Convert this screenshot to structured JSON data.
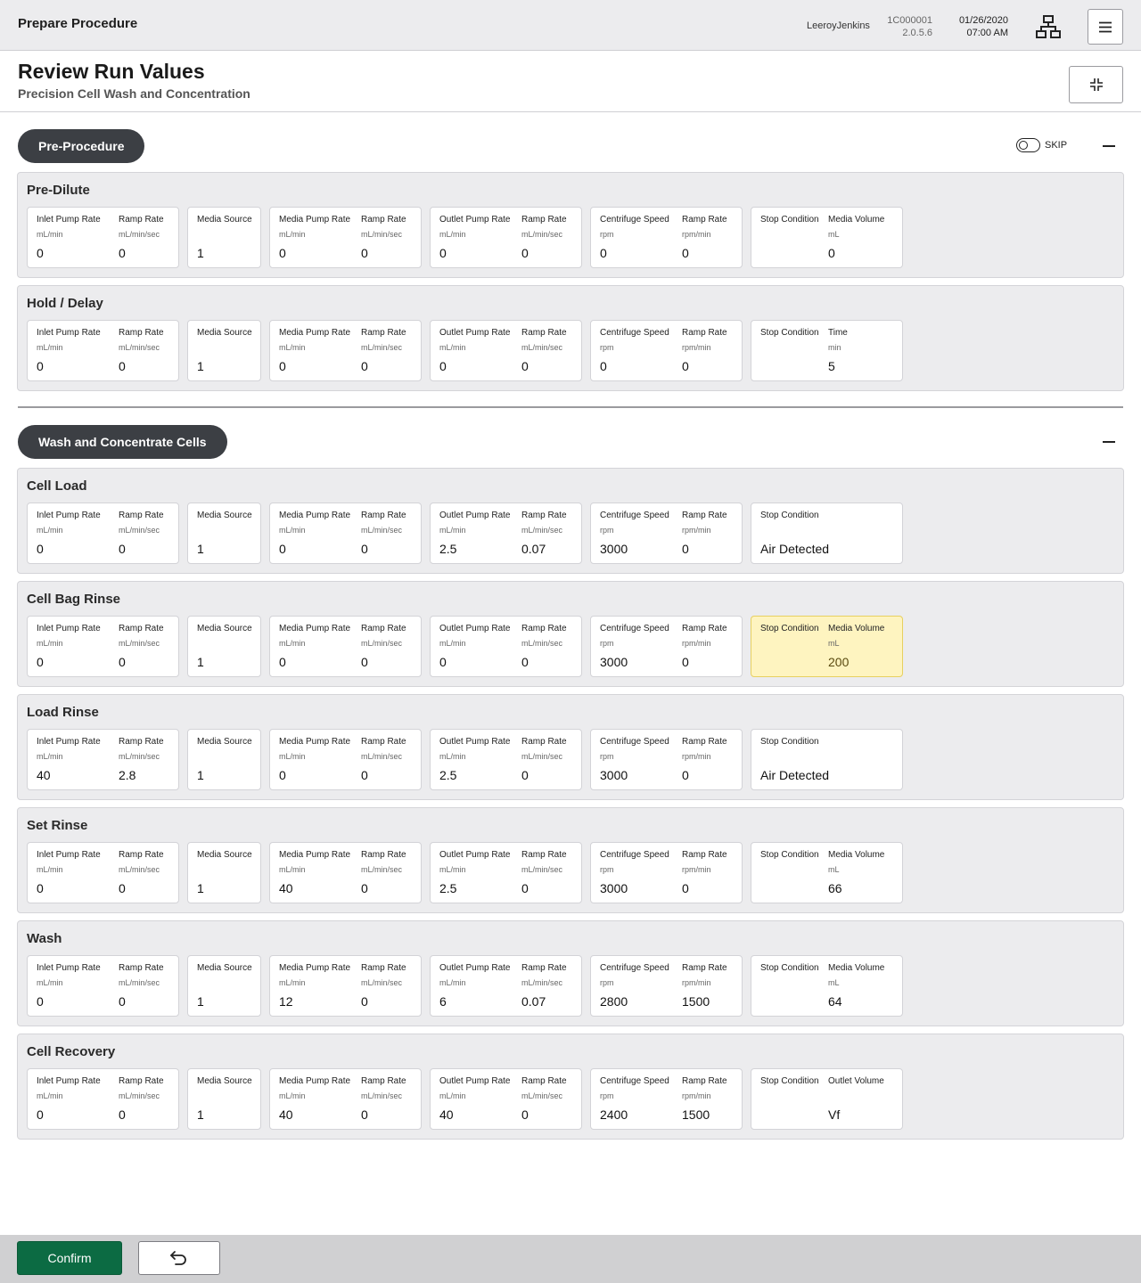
{
  "topbar": {
    "title": "Prepare Procedure",
    "user": "LeeroyJenkins",
    "device_id": "1C000001",
    "version": "2.0.5.6",
    "date": "01/26/2020",
    "time": "07:00 AM",
    "network_icon": "network-icon",
    "menu_icon": "hamburger-menu-icon"
  },
  "header": {
    "title": "Review Run Values",
    "subtitle": "Precision Cell Wash and Concentration",
    "collapse_icon": "collapse-icon"
  },
  "groups": [
    {
      "name": "Pre-Procedure",
      "skip_label": "SKIP",
      "skip_enabled": false,
      "steps": [
        {
          "title": "Pre-Dilute",
          "inlet": {
            "label": "Inlet Pump Rate",
            "unit": "mL/min",
            "value": "0",
            "ramp_label": "Ramp Rate",
            "ramp_unit": "mL/min/sec",
            "ramp_value": "0"
          },
          "media_source": {
            "label": "Media Source",
            "value": "1"
          },
          "media": {
            "label": "Media Pump Rate",
            "unit": "mL/min",
            "value": "0",
            "ramp_label": "Ramp Rate",
            "ramp_unit": "mL/min/sec",
            "ramp_value": "0"
          },
          "outlet": {
            "label": "Outlet Pump Rate",
            "unit": "mL/min",
            "value": "0",
            "ramp_label": "Ramp Rate",
            "ramp_unit": "mL/min/sec",
            "ramp_value": "0"
          },
          "centrifuge": {
            "label": "Centrifuge Speed",
            "unit": "rpm",
            "value": "0",
            "ramp_label": "Ramp Rate",
            "ramp_unit": "rpm/min",
            "ramp_value": "0"
          },
          "stop": {
            "label": "Stop Condition",
            "param_label": "Media Volume",
            "param_unit": "mL",
            "value": "0"
          }
        },
        {
          "title": "Hold / Delay",
          "inlet": {
            "label": "Inlet Pump Rate",
            "unit": "mL/min",
            "value": "0",
            "ramp_label": "Ramp Rate",
            "ramp_unit": "mL/min/sec",
            "ramp_value": "0"
          },
          "media_source": {
            "label": "Media Source",
            "value": "1"
          },
          "media": {
            "label": "Media Pump Rate",
            "unit": "mL/min",
            "value": "0",
            "ramp_label": "Ramp Rate",
            "ramp_unit": "mL/min/sec",
            "ramp_value": "0"
          },
          "outlet": {
            "label": "Outlet Pump Rate",
            "unit": "mL/min",
            "value": "0",
            "ramp_label": "Ramp Rate",
            "ramp_unit": "mL/min/sec",
            "ramp_value": "0"
          },
          "centrifuge": {
            "label": "Centrifuge Speed",
            "unit": "rpm",
            "value": "0",
            "ramp_label": "Ramp Rate",
            "ramp_unit": "rpm/min",
            "ramp_value": "0"
          },
          "stop": {
            "label": "Stop Condition",
            "param_label": "Time",
            "param_unit": "min",
            "value": "5"
          }
        }
      ]
    },
    {
      "name": "Wash and Concentrate Cells",
      "steps": [
        {
          "title": "Cell Load",
          "inlet": {
            "label": "Inlet Pump Rate",
            "unit": "mL/min",
            "value": "0",
            "ramp_label": "Ramp Rate",
            "ramp_unit": "mL/min/sec",
            "ramp_value": "0"
          },
          "media_source": {
            "label": "Media Source",
            "value": "1"
          },
          "media": {
            "label": "Media Pump Rate",
            "unit": "mL/min",
            "value": "0",
            "ramp_label": "Ramp Rate",
            "ramp_unit": "mL/min/sec",
            "ramp_value": "0"
          },
          "outlet": {
            "label": "Outlet Pump Rate",
            "unit": "mL/min",
            "value": "2.5",
            "ramp_label": "Ramp Rate",
            "ramp_unit": "mL/min/sec",
            "ramp_value": "0.07"
          },
          "centrifuge": {
            "label": "Centrifuge Speed",
            "unit": "rpm",
            "value": "3000",
            "ramp_label": "Ramp Rate",
            "ramp_unit": "rpm/min",
            "ramp_value": "0"
          },
          "stop": {
            "label": "Stop Condition",
            "value": "Air Detected"
          }
        },
        {
          "title": "Cell Bag Rinse",
          "inlet": {
            "label": "Inlet Pump Rate",
            "unit": "mL/min",
            "value": "0",
            "ramp_label": "Ramp Rate",
            "ramp_unit": "mL/min/sec",
            "ramp_value": "0"
          },
          "media_source": {
            "label": "Media Source",
            "value": "1"
          },
          "media": {
            "label": "Media Pump Rate",
            "unit": "mL/min",
            "value": "0",
            "ramp_label": "Ramp Rate",
            "ramp_unit": "mL/min/sec",
            "ramp_value": "0"
          },
          "outlet": {
            "label": "Outlet Pump Rate",
            "unit": "mL/min",
            "value": "0",
            "ramp_label": "Ramp Rate",
            "ramp_unit": "mL/min/sec",
            "ramp_value": "0"
          },
          "centrifuge": {
            "label": "Centrifuge Speed",
            "unit": "rpm",
            "value": "3000",
            "ramp_label": "Ramp Rate",
            "ramp_unit": "rpm/min",
            "ramp_value": "0"
          },
          "stop": {
            "label": "Stop Condition",
            "param_label": "Media Volume",
            "param_unit": "mL",
            "value": "200",
            "highlighted": true
          }
        },
        {
          "title": "Load Rinse",
          "inlet": {
            "label": "Inlet Pump Rate",
            "unit": "mL/min",
            "value": "40",
            "ramp_label": "Ramp Rate",
            "ramp_unit": "mL/min/sec",
            "ramp_value": "2.8"
          },
          "media_source": {
            "label": "Media Source",
            "value": "1"
          },
          "media": {
            "label": "Media Pump Rate",
            "unit": "mL/min",
            "value": "0",
            "ramp_label": "Ramp Rate",
            "ramp_unit": "mL/min/sec",
            "ramp_value": "0"
          },
          "outlet": {
            "label": "Outlet Pump Rate",
            "unit": "mL/min",
            "value": "2.5",
            "ramp_label": "Ramp Rate",
            "ramp_unit": "mL/min/sec",
            "ramp_value": "0"
          },
          "centrifuge": {
            "label": "Centrifuge Speed",
            "unit": "rpm",
            "value": "3000",
            "ramp_label": "Ramp Rate",
            "ramp_unit": "rpm/min",
            "ramp_value": "0"
          },
          "stop": {
            "label": "Stop Condition",
            "value": "Air Detected"
          }
        },
        {
          "title": "Set Rinse",
          "inlet": {
            "label": "Inlet Pump Rate",
            "unit": "mL/min",
            "value": "0",
            "ramp_label": "Ramp Rate",
            "ramp_unit": "mL/min/sec",
            "ramp_value": "0"
          },
          "media_source": {
            "label": "Media Source",
            "value": "1"
          },
          "media": {
            "label": "Media Pump Rate",
            "unit": "mL/min",
            "value": "40",
            "ramp_label": "Ramp Rate",
            "ramp_unit": "mL/min/sec",
            "ramp_value": "0"
          },
          "outlet": {
            "label": "Outlet Pump Rate",
            "unit": "mL/min",
            "value": "2.5",
            "ramp_label": "Ramp Rate",
            "ramp_unit": "mL/min/sec",
            "ramp_value": "0"
          },
          "centrifuge": {
            "label": "Centrifuge Speed",
            "unit": "rpm",
            "value": "3000",
            "ramp_label": "Ramp Rate",
            "ramp_unit": "rpm/min",
            "ramp_value": "0"
          },
          "stop": {
            "label": "Stop Condition",
            "param_label": "Media Volume",
            "param_unit": "mL",
            "value": "66"
          }
        },
        {
          "title": "Wash",
          "inlet": {
            "label": "Inlet Pump Rate",
            "unit": "mL/min",
            "value": "0",
            "ramp_label": "Ramp Rate",
            "ramp_unit": "mL/min/sec",
            "ramp_value": "0"
          },
          "media_source": {
            "label": "Media Source",
            "value": "1"
          },
          "media": {
            "label": "Media Pump Rate",
            "unit": "mL/min",
            "value": "12",
            "ramp_label": "Ramp Rate",
            "ramp_unit": "mL/min/sec",
            "ramp_value": "0"
          },
          "outlet": {
            "label": "Outlet Pump Rate",
            "unit": "mL/min",
            "value": "6",
            "ramp_label": "Ramp Rate",
            "ramp_unit": "mL/min/sec",
            "ramp_value": "0.07"
          },
          "centrifuge": {
            "label": "Centrifuge Speed",
            "unit": "rpm",
            "value": "2800",
            "ramp_label": "Ramp Rate",
            "ramp_unit": "rpm/min",
            "ramp_value": "1500"
          },
          "stop": {
            "label": "Stop Condition",
            "param_label": "Media Volume",
            "param_unit": "mL",
            "value": "64"
          }
        },
        {
          "title": "Cell Recovery",
          "inlet": {
            "label": "Inlet Pump Rate",
            "unit": "mL/min",
            "value": "0",
            "ramp_label": "Ramp Rate",
            "ramp_unit": "mL/min/sec",
            "ramp_value": "0"
          },
          "media_source": {
            "label": "Media Source",
            "value": "1"
          },
          "media": {
            "label": "Media Pump Rate",
            "unit": "mL/min",
            "value": "40",
            "ramp_label": "Ramp Rate",
            "ramp_unit": "mL/min/sec",
            "ramp_value": "0"
          },
          "outlet": {
            "label": "Outlet Pump Rate",
            "unit": "mL/min",
            "value": "40",
            "ramp_label": "Ramp Rate",
            "ramp_unit": "mL/min/sec",
            "ramp_value": "0"
          },
          "centrifuge": {
            "label": "Centrifuge Speed",
            "unit": "rpm",
            "value": "2400",
            "ramp_label": "Ramp Rate",
            "ramp_unit": "rpm/min",
            "ramp_value": "1500"
          },
          "stop": {
            "label": "Stop Condition",
            "param_label": "Outlet Volume",
            "value": "Vf"
          }
        }
      ]
    }
  ],
  "footer": {
    "confirm_label": "Confirm",
    "back_icon": "undo-arrow-icon"
  },
  "colors": {
    "pill": "#3c3f44",
    "confirm": "#0c6b43",
    "highlight": "#fef4c0",
    "panel": "#ececee"
  }
}
